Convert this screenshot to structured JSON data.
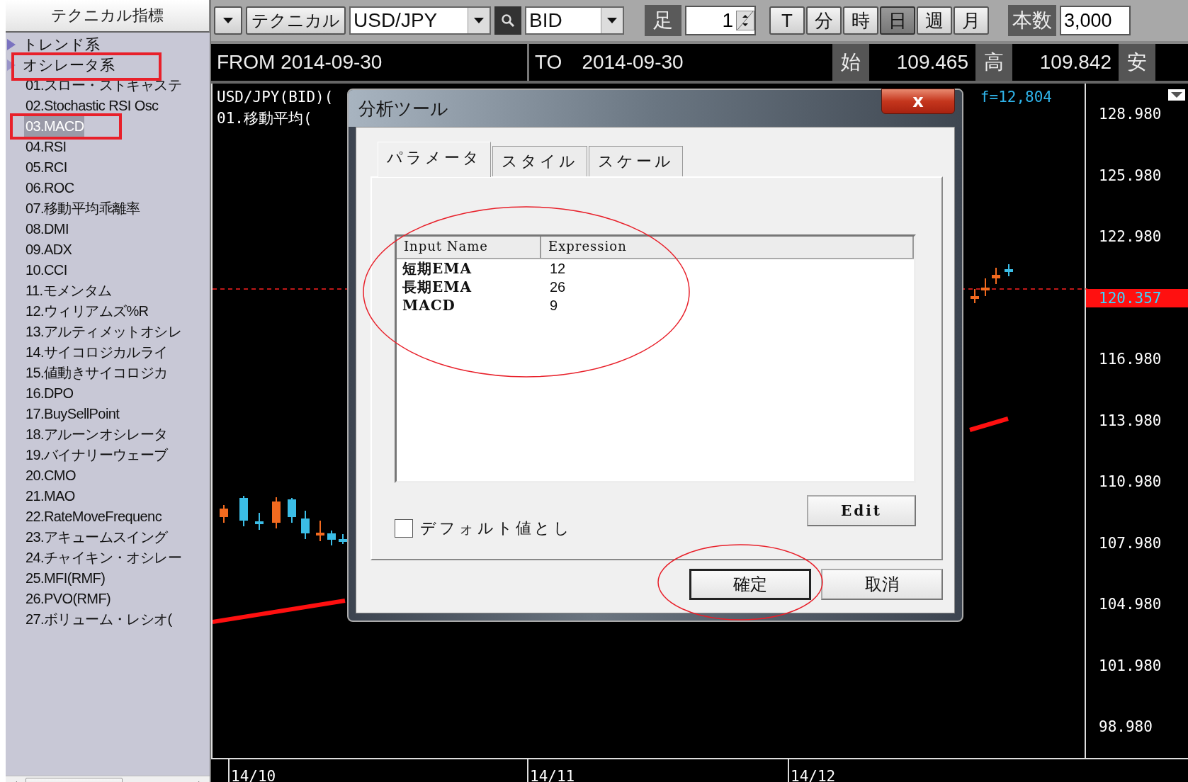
{
  "sidebar": {
    "title": "テクニカル指標",
    "categories": [
      {
        "label": "トレンド系",
        "expanded": false
      },
      {
        "label": "オシレータ系",
        "expanded": true,
        "children": [
          {
            "label": "01.スロー・ストキャステ",
            "selected": false
          },
          {
            "label": "02.Stochastic RSI Osc",
            "selected": false
          },
          {
            "label": "03.MACD",
            "selected": true
          },
          {
            "label": "04.RSI",
            "selected": false
          },
          {
            "label": "05.RCI",
            "selected": false
          },
          {
            "label": "06.ROC",
            "selected": false
          },
          {
            "label": "07.移動平均乖離率",
            "selected": false
          },
          {
            "label": "08.DMI",
            "selected": false
          },
          {
            "label": "09.ADX",
            "selected": false
          },
          {
            "label": "10.CCI",
            "selected": false
          },
          {
            "label": "11.モメンタム",
            "selected": false
          },
          {
            "label": "12.ウィリアムズ%R",
            "selected": false
          },
          {
            "label": "13.アルティメットオシレ",
            "selected": false
          },
          {
            "label": "14.サイコロジカルライ",
            "selected": false
          },
          {
            "label": "15.値動きサイコロジカ",
            "selected": false
          },
          {
            "label": "16.DPO",
            "selected": false
          },
          {
            "label": "17.BuySellPoint",
            "selected": false
          },
          {
            "label": "18.アルーンオシレータ",
            "selected": false
          },
          {
            "label": "19.バイナリーウェーブ",
            "selected": false
          },
          {
            "label": "20.CMO",
            "selected": false
          },
          {
            "label": "21.MAO",
            "selected": false
          },
          {
            "label": "22.RateMoveFrequenc",
            "selected": false
          },
          {
            "label": "23.アキュームスイング",
            "selected": false
          },
          {
            "label": "24.チャイキン・オシレー",
            "selected": false
          },
          {
            "label": "25.MFI(RMF)",
            "selected": false
          },
          {
            "label": "26.PVO(RMF)",
            "selected": false
          },
          {
            "label": "27.ボリューム・レシオ(",
            "selected": false
          }
        ]
      }
    ]
  },
  "toolbar": {
    "technical_button": "テクニカル",
    "symbol": "USD/JPY",
    "price_type": "BID",
    "bar_label": "足",
    "bar_value": "1",
    "periods": [
      {
        "label": "T",
        "selected": false
      },
      {
        "label": "分",
        "selected": false
      },
      {
        "label": "時",
        "selected": false
      },
      {
        "label": "日",
        "selected": true
      },
      {
        "label": "週",
        "selected": false
      },
      {
        "label": "月",
        "selected": false
      }
    ],
    "count_label": "本数",
    "count_value": "3,000"
  },
  "info": {
    "from": "FROM 2014-09-30",
    "to": "TO　2014-09-30",
    "fields": [
      {
        "label": "始",
        "value": "109.465"
      },
      {
        "label": "高",
        "value": "109.842"
      },
      {
        "label": "安"
      }
    ]
  },
  "chart": {
    "header_lines": [
      "USD/JPY(BID)(",
      "01.移動平均("
    ],
    "header_note": "f=12,804",
    "price_axis": [
      {
        "kind": "tick",
        "label": "128.980"
      },
      {
        "kind": "tick",
        "label": "125.980"
      },
      {
        "kind": "tick",
        "label": "122.980"
      },
      {
        "kind": "current",
        "label": "120.357"
      },
      {
        "kind": "tick",
        "label": "116.980"
      },
      {
        "kind": "tick",
        "label": "113.980"
      },
      {
        "kind": "tick",
        "label": "110.980"
      },
      {
        "kind": "tick",
        "label": "107.980"
      },
      {
        "kind": "tick",
        "label": "104.980"
      },
      {
        "kind": "tick",
        "label": "101.980"
      },
      {
        "kind": "tick",
        "label": "98.980"
      }
    ],
    "time_axis": [
      "14/10",
      "14/11",
      "14/12"
    ]
  },
  "dialog": {
    "title": "分析ツール",
    "close_label": "x",
    "tabs": [
      {
        "label": "パラメータ",
        "selected": true
      },
      {
        "label": "スタイル",
        "selected": false
      },
      {
        "label": "スケール",
        "selected": false
      }
    ],
    "columns": [
      "Input Name",
      "Expression"
    ],
    "rows": [
      {
        "name": "短期EMA",
        "value": "12"
      },
      {
        "name": "長期EMA",
        "value": "26"
      },
      {
        "name": "MACD",
        "value": "9"
      }
    ],
    "default_checkbox": {
      "label": "デフォルト値とし",
      "checked": false
    },
    "edit_button": "Edit",
    "ok_button": "確定",
    "cancel_button": "取消"
  }
}
